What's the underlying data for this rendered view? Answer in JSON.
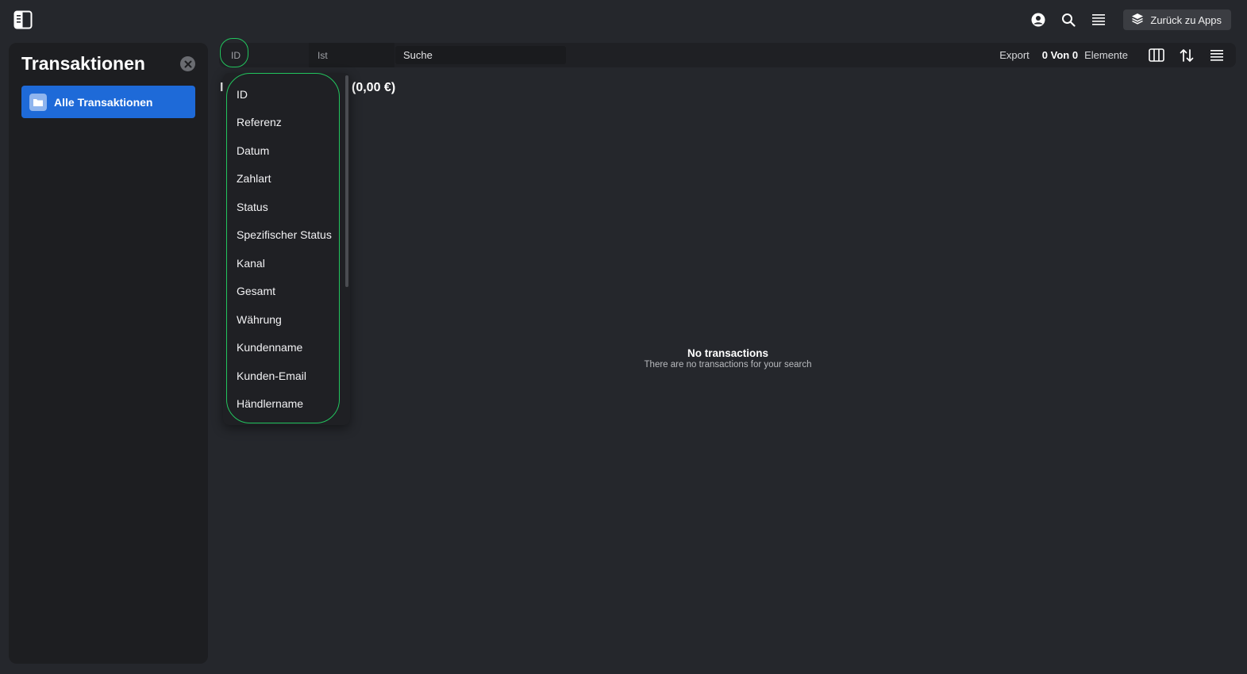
{
  "topbar": {
    "apps_button_label": "Zurück zu Apps"
  },
  "sidebar": {
    "title": "Transaktionen",
    "items": [
      {
        "label": "Alle Transaktionen",
        "active": true
      }
    ]
  },
  "filter": {
    "field": "ID",
    "operator": "Ist",
    "search_placeholder": "Suche",
    "export_label": "Export",
    "count_text": "0 Von 0",
    "elements_label": "Elemente"
  },
  "summary": {
    "prefix": "I",
    "total": "(0,00 €)"
  },
  "dropdown": {
    "options": [
      "ID",
      "Referenz",
      "Datum",
      "Zahlart",
      "Status",
      "Spezifischer Status",
      "Kanal",
      "Gesamt",
      "Währung",
      "Kundenname",
      "Kunden-Email",
      "Händlername"
    ]
  },
  "empty_state": {
    "title": "No transactions",
    "subtitle": "There are no transactions for your search"
  },
  "colors": {
    "background": "#25272c",
    "panel": "#1d1e21",
    "accent": "#1e6ad8",
    "highlight": "#22c55e"
  }
}
